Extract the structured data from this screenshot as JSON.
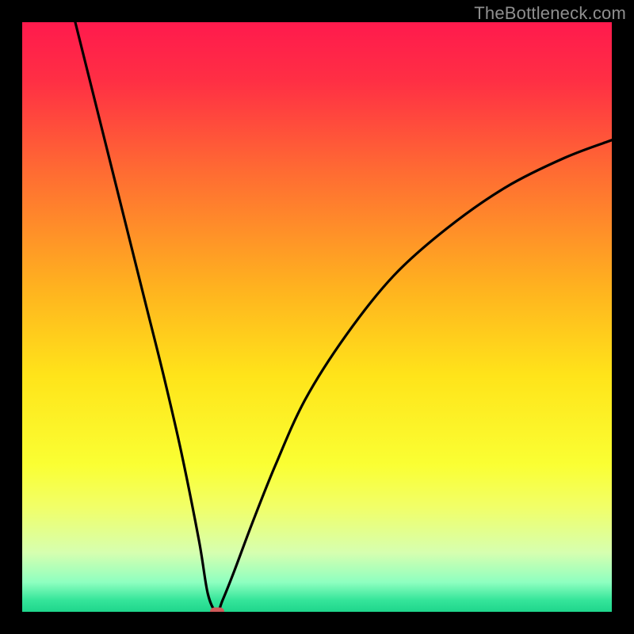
{
  "watermark": "TheBottleneck.com",
  "chart_data": {
    "type": "line",
    "title": "",
    "xlabel": "",
    "ylabel": "",
    "xlim": [
      0,
      100
    ],
    "ylim": [
      0,
      100
    ],
    "gradient_stops": [
      {
        "offset": 0,
        "color": "#ff1a4d"
      },
      {
        "offset": 10,
        "color": "#ff2f44"
      },
      {
        "offset": 25,
        "color": "#ff6a33"
      },
      {
        "offset": 45,
        "color": "#ffb21f"
      },
      {
        "offset": 60,
        "color": "#ffe41a"
      },
      {
        "offset": 75,
        "color": "#faff33"
      },
      {
        "offset": 82,
        "color": "#f2ff66"
      },
      {
        "offset": 90,
        "color": "#d6ffb0"
      },
      {
        "offset": 95,
        "color": "#8effc0"
      },
      {
        "offset": 98,
        "color": "#35e59a"
      },
      {
        "offset": 100,
        "color": "#1fd68c"
      }
    ],
    "series": [
      {
        "name": "bottleneck-curve",
        "x": [
          9,
          12,
          15,
          18,
          21,
          24,
          27,
          30,
          31.5,
          33,
          34,
          36,
          39,
          43,
          48,
          55,
          63,
          72,
          82,
          92,
          100
        ],
        "y": [
          100,
          88,
          76,
          64,
          52,
          40,
          27,
          12,
          3,
          0,
          2,
          7,
          15,
          25,
          36,
          47,
          57,
          65,
          72,
          77,
          80
        ]
      }
    ],
    "marker": {
      "x": 33,
      "y": 0,
      "color": "#d05a5a"
    }
  }
}
